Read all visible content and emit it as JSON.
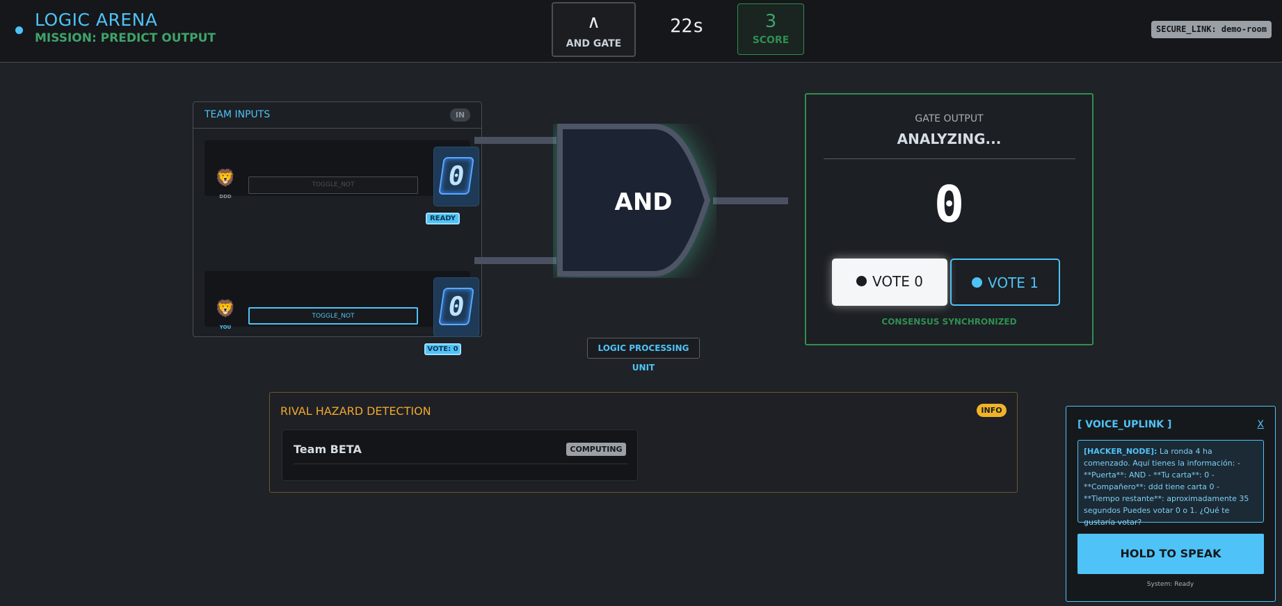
{
  "header": {
    "title": "LOGIC ARENA",
    "mission": "MISSION: PREDICT OUTPUT",
    "gate_symbol": "∧",
    "gate_label": "AND GATE",
    "timer": "22s",
    "score_value": "3",
    "score_label": "SCORE",
    "secure_link": "SECURE_LINK: demo-room"
  },
  "team": {
    "title": "TEAM INPUTS",
    "badge": "IN",
    "players": [
      {
        "name": "DDD",
        "toggle": "TOGGLE_NOT",
        "card_value": "0",
        "status": "READY"
      },
      {
        "name": "YOU",
        "toggle": "TOGGLE_NOT",
        "card_value": "0",
        "status": "VOTE: 0"
      }
    ]
  },
  "gate": {
    "label": "AND",
    "unit_label": "LOGIC PROCESSING UNIT"
  },
  "output": {
    "label": "GATE OUTPUT",
    "status": "ANALYZING...",
    "value": "0",
    "vote0": "VOTE 0",
    "vote1": "VOTE 1",
    "consensus": "CONSENSUS SYNCHRONIZED"
  },
  "rival": {
    "title": "RIVAL HAZARD DETECTION",
    "badge": "INFO",
    "team": "Team BETA",
    "status": "COMPUTING"
  },
  "voice": {
    "title": "[ VOICE_UPLINK ]",
    "close": "X",
    "sender": "[HACKER_NODE]:",
    "message": " La ronda 4 ha comenzado. Aquí tienes la información: - **Puerta**: AND - **Tu carta**: 0 - **Compañero**: ddd tiene carta 0 - **Tiempo restante**: aproximadamente 35 segundos Puedes votar 0 o 1. ¿Qué te gustaría votar?",
    "button": "HOLD TO SPEAK",
    "system_status": "System: Ready"
  },
  "colors": {
    "accent": "#4fc3f7",
    "success": "#2f8f52",
    "warning": "#f0a830",
    "background": "#1f2226"
  }
}
